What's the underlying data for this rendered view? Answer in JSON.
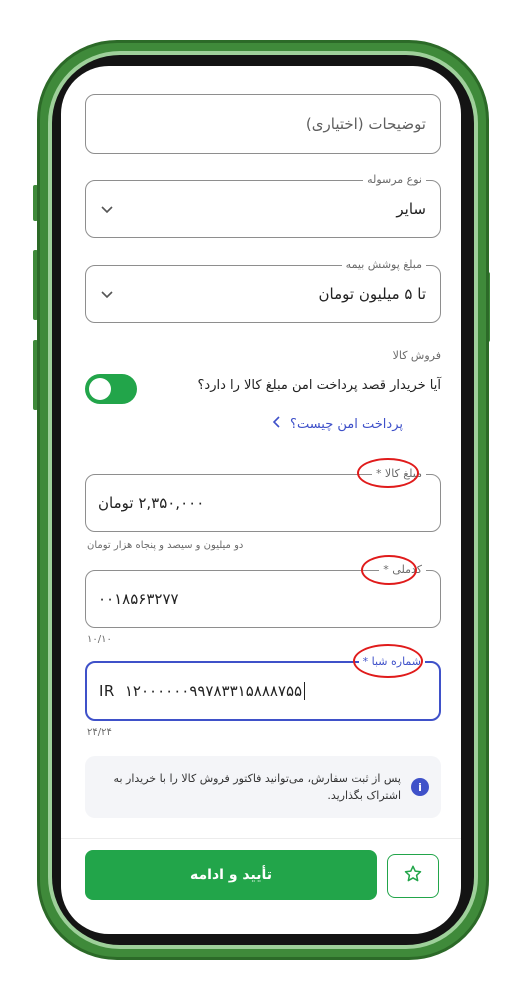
{
  "description_field": {
    "placeholder": "توضیحات (اختیاری)"
  },
  "shipment_type": {
    "label": "نوع مرسوله",
    "value": "سایر"
  },
  "insurance": {
    "label": "مبلغ پوشش بیمه",
    "value": "تا ۵ میلیون تومان"
  },
  "goods_sale": {
    "section_label": "فروش کالا",
    "question": "آیا خریدار قصد پرداخت امن مبلغ کالا را دارد؟",
    "toggle_on": true,
    "link_text": "پرداخت امن چیست؟"
  },
  "goods_amount": {
    "label": "مبلغ کالا *",
    "value": "۲,۳۵۰,۰۰۰ تومان",
    "helper": "دو میلیون و سیصد و پنجاه هزار تومان"
  },
  "national_code": {
    "label": "کدملی *",
    "value": "۰۰۱۸۵۶۳۲۷۷",
    "counter": "۱۰/۱۰"
  },
  "sheba": {
    "label": "شماره شبا *",
    "prefix": "IR",
    "value": "۱۲۰۰۰۰۰۰۹۹۷۸۳۳۱۵۸۸۸۷۵۵",
    "counter": "۲۴/۲۴"
  },
  "info": {
    "text": "پس از ثبت سفارش، می‌توانید فاکتور فروش کالا را با خریدار به اشتراک بگذارید."
  },
  "footer": {
    "confirm_label": "تأیید و ادامه"
  },
  "colors": {
    "accent_green": "#22a54a",
    "focus_blue": "#3f51c9",
    "annotation_red": "#e01b1b",
    "phone_green": "#3f8a3a"
  }
}
